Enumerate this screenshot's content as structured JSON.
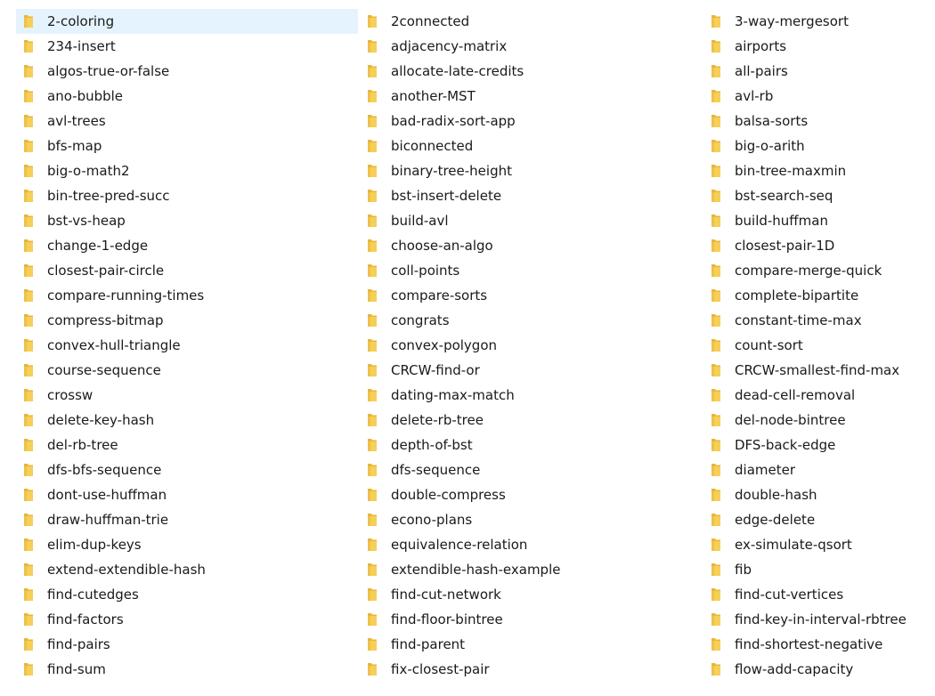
{
  "folder_icon_name": "folder-icon",
  "colors": {
    "selection": "#e5f3ff",
    "text": "#1a1a1a",
    "folder_body": "#f6cf59",
    "folder_flap": "#e8b63b"
  },
  "selected_item": "2-coloring",
  "columns": [
    {
      "items": [
        "2-coloring",
        "234-insert",
        "algos-true-or-false",
        "ano-bubble",
        "avl-trees",
        "bfs-map",
        "big-o-math2",
        "bin-tree-pred-succ",
        "bst-vs-heap",
        "change-1-edge",
        "closest-pair-circle",
        "compare-running-times",
        "compress-bitmap",
        "convex-hull-triangle",
        "course-sequence",
        "crossw",
        "delete-key-hash",
        "del-rb-tree",
        "dfs-bfs-sequence",
        "dont-use-huffman",
        "draw-huffman-trie",
        "elim-dup-keys",
        "extend-extendible-hash",
        "find-cutedges",
        "find-factors",
        "find-pairs",
        "find-sum"
      ]
    },
    {
      "items": [
        "2connected",
        "adjacency-matrix",
        "allocate-late-credits",
        "another-MST",
        "bad-radix-sort-app",
        "biconnected",
        "binary-tree-height",
        "bst-insert-delete",
        "build-avl",
        "choose-an-algo",
        "coll-points",
        "compare-sorts",
        "congrats",
        "convex-polygon",
        "CRCW-find-or",
        "dating-max-match",
        "delete-rb-tree",
        "depth-of-bst",
        "dfs-sequence",
        "double-compress",
        "econo-plans",
        "equivalence-relation",
        "extendible-hash-example",
        "find-cut-network",
        "find-floor-bintree",
        "find-parent",
        "fix-closest-pair"
      ]
    },
    {
      "items": [
        "3-way-mergesort",
        "airports",
        "all-pairs",
        "avl-rb",
        "balsa-sorts",
        "big-o-arith",
        "bin-tree-maxmin",
        "bst-search-seq",
        "build-huffman",
        "closest-pair-1D",
        "compare-merge-quick",
        "complete-bipartite",
        "constant-time-max",
        "count-sort",
        "CRCW-smallest-find-max",
        "dead-cell-removal",
        "del-node-bintree",
        "DFS-back-edge",
        "diameter",
        "double-hash",
        "edge-delete",
        "ex-simulate-qsort",
        "fib",
        "find-cut-vertices",
        "find-key-in-interval-rbtree",
        "find-shortest-negative",
        "flow-add-capacity"
      ]
    }
  ]
}
